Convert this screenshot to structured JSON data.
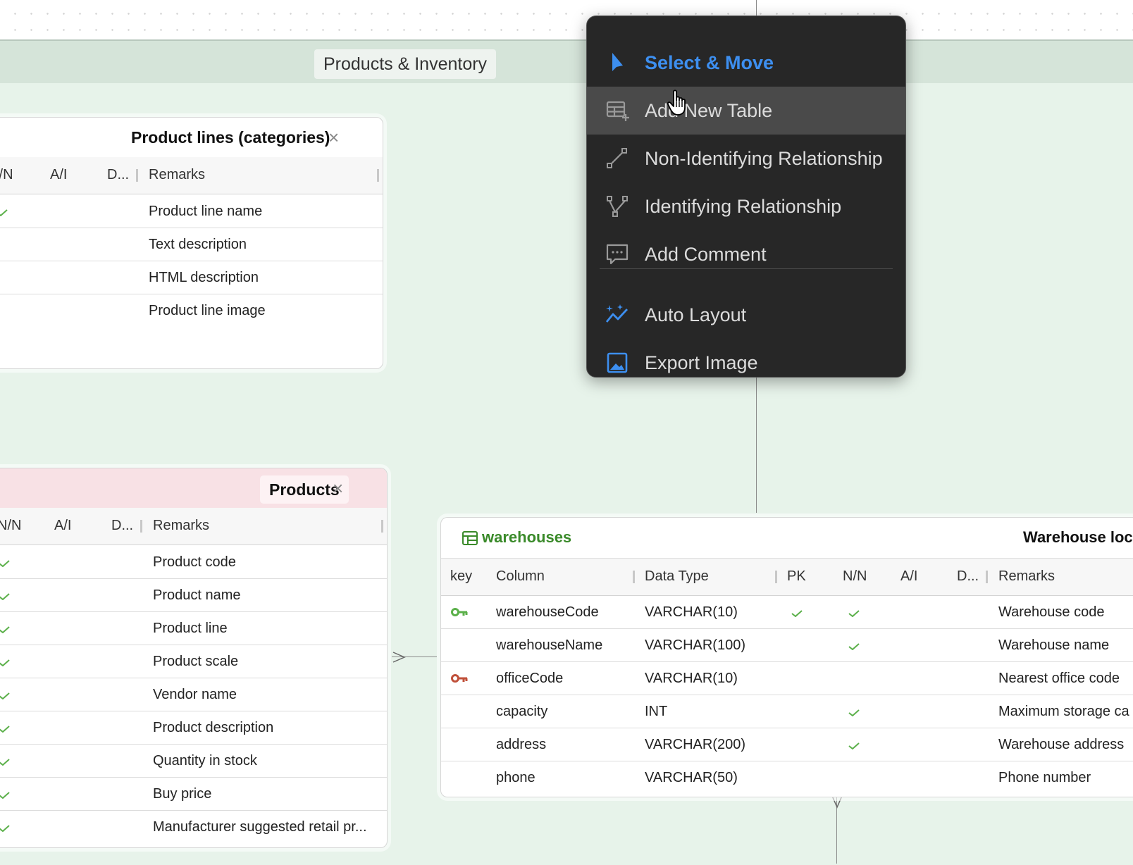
{
  "area": {
    "title": "Products & Inventory",
    "color": "#e7f3ea"
  },
  "product_lines": {
    "title": "Product lines (categories)",
    "close_icon": "close-icon",
    "columns": [
      "I/N",
      "A/I",
      "D...",
      "Remarks"
    ],
    "rows": [
      {
        "nn": true,
        "remarks": "Product line name"
      },
      {
        "nn": false,
        "remarks": "Text description"
      },
      {
        "nn": false,
        "remarks": "HTML description"
      },
      {
        "nn": false,
        "remarks": "Product line image"
      }
    ]
  },
  "products": {
    "title": "Products",
    "header_color": "#f8e1e5",
    "columns": [
      "N/N",
      "A/I",
      "D...",
      "Remarks"
    ],
    "rows": [
      {
        "nn": true,
        "remarks": "Product code"
      },
      {
        "nn": true,
        "remarks": "Product name"
      },
      {
        "nn": true,
        "remarks": "Product line"
      },
      {
        "nn": true,
        "remarks": "Product scale"
      },
      {
        "nn": true,
        "remarks": "Vendor name"
      },
      {
        "nn": true,
        "remarks": "Product description"
      },
      {
        "nn": true,
        "remarks": "Quantity in stock"
      },
      {
        "nn": true,
        "remarks": "Buy price"
      },
      {
        "nn": true,
        "remarks": "Manufacturer suggested retail pr..."
      }
    ]
  },
  "warehouses": {
    "name": "warehouses",
    "title": "Warehouse loc",
    "name_color": "#3a8a2a",
    "columns": [
      "key",
      "Column",
      "Data Type",
      "PK",
      "N/N",
      "A/I",
      "D...",
      "Remarks"
    ],
    "rows": [
      {
        "key": "primary",
        "column": "warehouseCode",
        "type": "VARCHAR(10)",
        "pk": true,
        "nn": true,
        "remarks": "Warehouse code"
      },
      {
        "key": "",
        "column": "warehouseName",
        "type": "VARCHAR(100)",
        "pk": false,
        "nn": true,
        "remarks": "Warehouse name"
      },
      {
        "key": "foreign",
        "column": "officeCode",
        "type": "VARCHAR(10)",
        "pk": false,
        "nn": false,
        "remarks": "Nearest office code"
      },
      {
        "key": "",
        "column": "capacity",
        "type": "INT",
        "pk": false,
        "nn": true,
        "remarks": "Maximum storage ca"
      },
      {
        "key": "",
        "column": "address",
        "type": "VARCHAR(200)",
        "pk": false,
        "nn": true,
        "remarks": "Warehouse address"
      },
      {
        "key": "",
        "column": "phone",
        "type": "VARCHAR(50)",
        "pk": false,
        "nn": false,
        "remarks": "Phone number"
      }
    ]
  },
  "menu": {
    "items": [
      {
        "label": "Select & Move",
        "icon": "cursor-arrow-icon",
        "active": true
      },
      {
        "label": "Add New Table",
        "icon": "table-add-icon",
        "hover": true
      },
      {
        "label": "Non-Identifying Relationship",
        "icon": "non-identifying-relation-icon"
      },
      {
        "label": "Identifying Relationship",
        "icon": "identifying-relation-icon"
      },
      {
        "label": "Add Comment",
        "icon": "comment-icon"
      },
      {
        "label": "Auto Layout",
        "icon": "auto-layout-icon"
      },
      {
        "label": "Export Image",
        "icon": "image-icon"
      }
    ]
  },
  "colors": {
    "check": "#5bb04a",
    "primary_key": "#5bb04a",
    "foreign_key": "#c0503a",
    "accent": "#3d8ff0"
  }
}
